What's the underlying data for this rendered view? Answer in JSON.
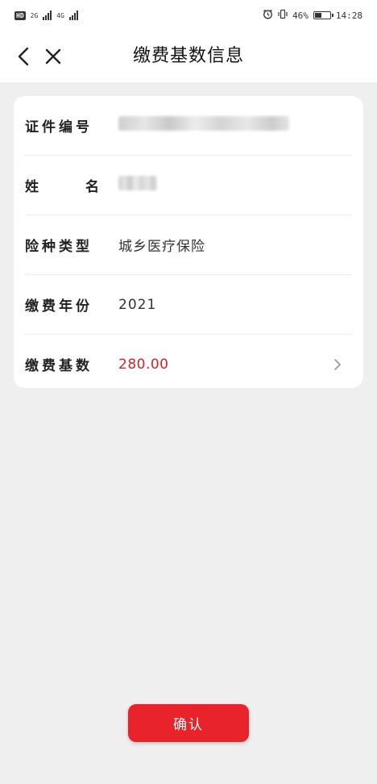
{
  "status_bar": {
    "left_badge": "HD",
    "network_2g": "2G",
    "network_4g": "4G",
    "battery_text": "46%",
    "battery_level": 0.46,
    "time": "14:28"
  },
  "nav": {
    "title": "缴费基数信息",
    "back_icon": "chevron-left-icon",
    "close_icon": "close-icon"
  },
  "info": {
    "id_number": {
      "label": "证件编号",
      "value_masked": true
    },
    "name": {
      "label_chars": [
        "姓",
        "名"
      ],
      "value_masked": true
    },
    "insurance_type": {
      "label": "险种类型",
      "value": "城乡医疗保险"
    },
    "payment_year": {
      "label": "缴费年份",
      "value": "2021"
    },
    "payment_base": {
      "label": "缴费基数",
      "value": "280.00",
      "value_color": "#d0232a"
    }
  },
  "actions": {
    "confirm_label": "确认",
    "confirm_color": "#e8232b"
  }
}
